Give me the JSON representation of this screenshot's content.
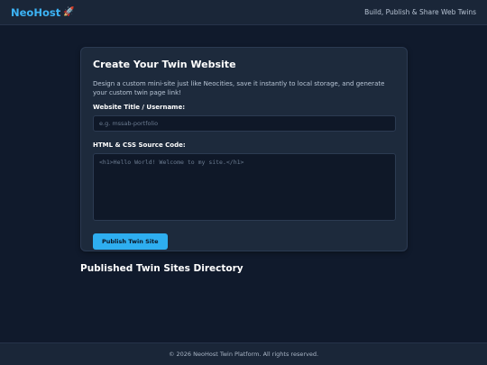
{
  "header": {
    "logo_text": "NeoHost",
    "logo_icon": "rocket-icon",
    "logo_emoji": "🚀",
    "tagline": "Build, Publish & Share Web Twins"
  },
  "create_card": {
    "title": "Create Your Twin Website",
    "description": "Design a custom mini-site just like Neocities, save it instantly to local storage, and generate your custom twin page link!",
    "title_field": {
      "label": "Website Title / Username:",
      "value": "",
      "placeholder": "e.g. mssab-portfolio"
    },
    "code_field": {
      "label": "HTML & CSS Source Code:",
      "value": "",
      "placeholder": "<h1>Hello World! Welcome to my site.</h1>"
    },
    "publish_label": "Publish Twin Site"
  },
  "directory": {
    "title": "Published Twin Sites Directory"
  },
  "footer": {
    "text": "© 2026 NeoHost Twin Platform. All rights reserved."
  },
  "colors": {
    "background": "#101a2c",
    "card": "#1d2a3c",
    "accent": "#2eaef0",
    "logo": "#3cb3f5"
  }
}
